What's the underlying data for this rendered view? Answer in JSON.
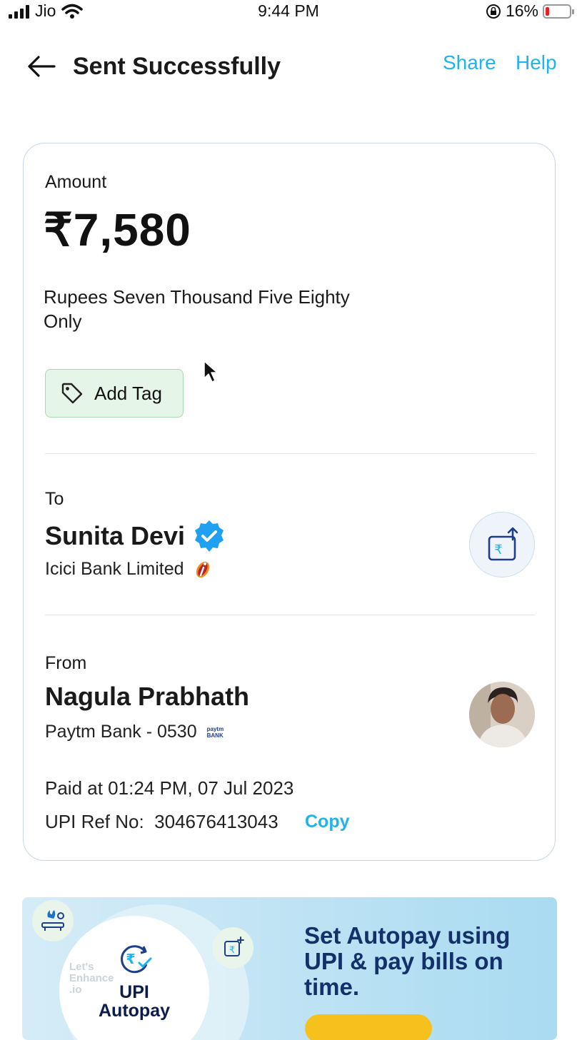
{
  "status_bar": {
    "carrier": "Jio",
    "time": "9:44 PM",
    "battery": "16%",
    "battery_level": 0.16
  },
  "header": {
    "title": "Sent Successfully",
    "share": "Share",
    "help": "Help"
  },
  "amount": {
    "label": "Amount",
    "value": "₹7,580",
    "words": "Rupees Seven Thousand Five Eighty Only",
    "add_tag": "Add Tag"
  },
  "to": {
    "label": "To",
    "name": "Sunita Devi",
    "bank": "Icici Bank Limited"
  },
  "from": {
    "label": "From",
    "name": "Nagula Prabhath",
    "bank": "Paytm Bank - 0530",
    "bank_logo_text": "paytm BANK"
  },
  "details": {
    "paid_at": "Paid at 01:24 PM, 07 Jul 2023",
    "upi_ref": "UPI Ref No:  304676413043",
    "copy": "Copy"
  },
  "banner": {
    "badge_line1": "UPI",
    "badge_line2": "Autopay",
    "headline": "Set Autopay using UPI & pay bills on time.",
    "watermark": "Let's Enhance .io"
  },
  "colors": {
    "accent": "#1fb4ec",
    "verified": "#1fa0f0",
    "tag_bg": "#e5f5e7",
    "banner_navy": "#13306b",
    "cta": "#f6c11c"
  }
}
